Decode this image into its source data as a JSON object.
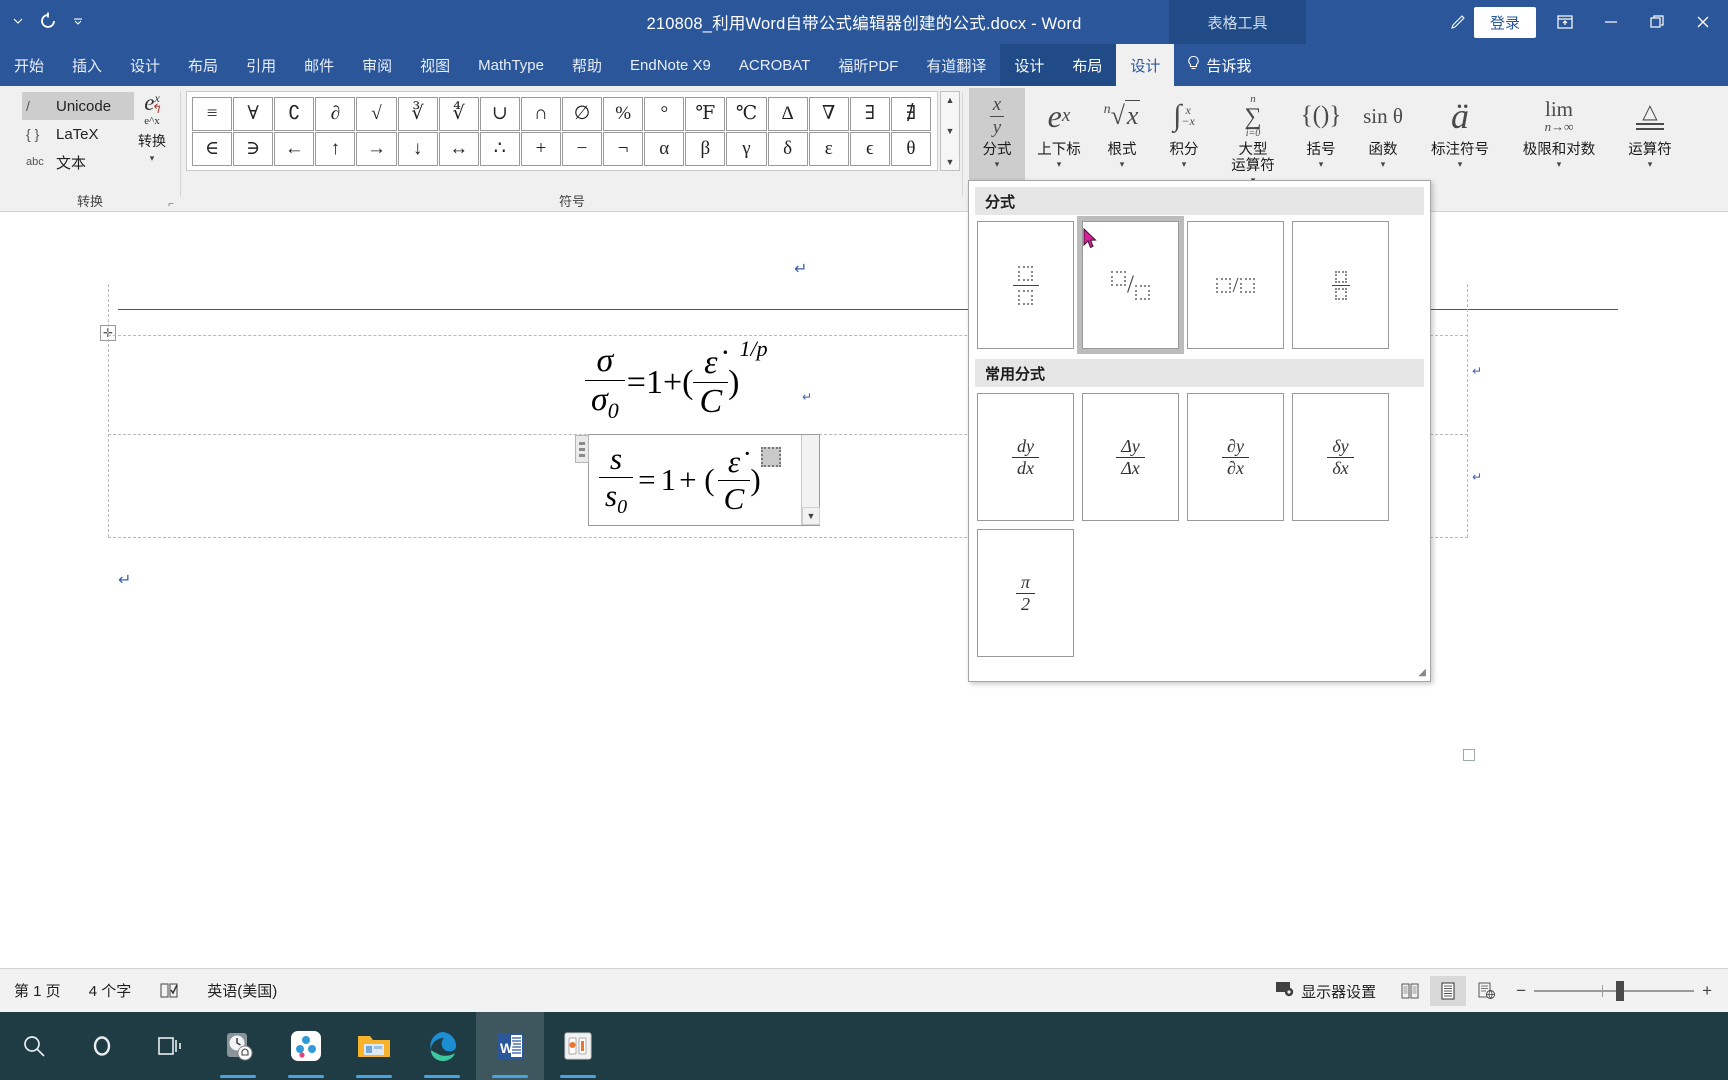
{
  "titlebar": {
    "document_title": "210808_利用Word自带公式编辑器创建的公式.docx  -  Word",
    "context_tool_label": "表格工具",
    "signin_label": "登录",
    "qat": [
      {
        "name": "autosave-caret",
        "label": "▾"
      },
      {
        "name": "undo-icon",
        "label": "↺"
      },
      {
        "name": "customize-qat-caret",
        "label": "⌄"
      }
    ],
    "window_controls": [
      {
        "name": "ribbon-display-options",
        "label": "⍐"
      },
      {
        "name": "minimize",
        "label": "—"
      },
      {
        "name": "restore",
        "label": "❐"
      },
      {
        "name": "close",
        "label": "✕"
      }
    ]
  },
  "ribbon_tabs": {
    "main": [
      "开始",
      "插入",
      "设计",
      "布局",
      "引用",
      "邮件",
      "审阅",
      "视图",
      "MathType",
      "帮助",
      "EndNote X9",
      "ACROBAT",
      "福昕PDF",
      "有道翻译"
    ],
    "contextual": [
      "设计",
      "布局"
    ],
    "active": "设计",
    "tellme_label": "告诉我"
  },
  "ribbon": {
    "groups": [
      {
        "name": "conversion",
        "label": "转换"
      },
      {
        "name": "symbols",
        "label": "符号"
      }
    ],
    "conversion": {
      "items": [
        {
          "mark": "/",
          "label": "Unicode",
          "selected": true
        },
        {
          "mark": "{ }",
          "label": "LaTeX",
          "selected": false
        },
        {
          "mark": "abc",
          "label": "文本",
          "selected": false
        }
      ],
      "convert_button": {
        "glyph": "e",
        "sup": "x",
        "sub": "e^x",
        "label": "转换",
        "caret": "▾"
      }
    },
    "symbols": {
      "row1": [
        "≡",
        "∀",
        "∁",
        "∂",
        "√",
        "∛",
        "∜",
        "∪",
        "∩",
        "∅",
        "%",
        "°",
        "℉",
        "℃",
        "Δ",
        "∇",
        "∃",
        "∄"
      ],
      "row2": [
        "∈",
        "∋",
        "←",
        "↑",
        "→",
        "↓",
        "↔",
        "∴",
        "+",
        "−",
        "¬",
        "α",
        "β",
        "γ",
        "δ",
        "ε",
        "ϵ",
        "θ"
      ],
      "scroll": [
        "▲",
        "▼",
        "▼"
      ]
    },
    "structures": [
      {
        "name": "fraction",
        "glyph_type": "frac",
        "num": "x",
        "den": "y",
        "label": "分式",
        "label2": "",
        "caret": "▾",
        "active": true
      },
      {
        "name": "script",
        "glyph_type": "text",
        "glyph": "e",
        "sup": "x",
        "label": "上下标",
        "label2": "",
        "caret": "▾",
        "active": false
      },
      {
        "name": "radical",
        "glyph_type": "radical",
        "glyph": "ⁿ√x",
        "label": "根式",
        "label2": "",
        "caret": "▾",
        "active": false
      },
      {
        "name": "integral",
        "glyph_type": "integral",
        "glyph": "∫",
        "sup": "x",
        "sub": "−x",
        "label": "积分",
        "label2": "",
        "caret": "▾",
        "active": false
      },
      {
        "name": "large-operator",
        "glyph_type": "sum",
        "glyph": "∑",
        "sup": "n",
        "sub": "i=0",
        "label": "大型",
        "label2": "运算符",
        "caret": "▾",
        "active": false
      },
      {
        "name": "bracket",
        "glyph_type": "text",
        "glyph": "{()}",
        "label": "括号",
        "label2": "",
        "caret": "▾",
        "active": false
      },
      {
        "name": "function",
        "glyph_type": "text",
        "glyph": "sin θ",
        "label": "函数",
        "label2": "",
        "caret": "▾",
        "active": false
      },
      {
        "name": "accent",
        "glyph_type": "accent",
        "glyph": "ä",
        "label": "标注符号",
        "label2": "",
        "caret": "▾",
        "active": false
      },
      {
        "name": "limit-log",
        "glyph_type": "limit",
        "glyph": "lim",
        "sub": "n→∞",
        "label": "极限和对数",
        "label2": "",
        "caret": "▾",
        "active": false
      },
      {
        "name": "operator",
        "glyph_type": "operator",
        "glyph": "≜",
        "label": "运算符",
        "label2": "",
        "caret": "▾",
        "active": false
      }
    ]
  },
  "gallery": {
    "sections": [
      {
        "name": "fraction-section",
        "header": "分式",
        "cells": [
          {
            "name": "stacked-fraction",
            "kind": "stacked-ph",
            "highlighted": false
          },
          {
            "name": "skewed-fraction",
            "kind": "skewed-ph",
            "highlighted": true
          },
          {
            "name": "linear-fraction",
            "kind": "linear-ph",
            "highlighted": false
          },
          {
            "name": "small-fraction",
            "kind": "small-ph",
            "highlighted": false
          }
        ]
      },
      {
        "name": "common-fraction-section",
        "header": "常用分式",
        "cells": [
          {
            "name": "dy-dx",
            "kind": "frac",
            "num": "dy",
            "den": "dx",
            "highlighted": false
          },
          {
            "name": "delta-y-delta-x",
            "kind": "frac",
            "num": "Δy",
            "den": "Δx",
            "highlighted": false
          },
          {
            "name": "partial-y-partial-x",
            "kind": "frac",
            "num": "∂y",
            "den": "∂x",
            "highlighted": false
          },
          {
            "name": "delta-small-y-x",
            "kind": "frac",
            "num": "δy",
            "den": "δx",
            "highlighted": false
          },
          {
            "name": "pi-over-2",
            "kind": "frac",
            "num": "π",
            "den": "2",
            "highlighted": false
          }
        ]
      }
    ]
  },
  "document": {
    "equation1": {
      "num": "σ",
      "den": "σ",
      "den_sub": "0",
      "equals": "=",
      "one_plus": "1+(",
      "inner_num": "ε̇",
      "inner_den": "C",
      "close_paren": ")",
      "exponent": "1/p"
    },
    "equation2": {
      "num": "s",
      "den": "s",
      "den_sub": "0",
      "equals": "=",
      "one": "1",
      "plus_paren": "+ (",
      "inner_num": "ε̇",
      "inner_den": "C",
      "close_paren": ")",
      "placeholder": "▨"
    }
  },
  "statusbar": {
    "page_info": "第 1 页",
    "word_count": "4 个字",
    "proofing_icon": "proofing-icon",
    "language": "英语(美国)",
    "display_settings": "显示器设置",
    "views": [
      {
        "name": "read-mode-view",
        "icon": "book-icon",
        "active": false
      },
      {
        "name": "print-layout-view",
        "icon": "page-icon",
        "active": true
      },
      {
        "name": "web-layout-view",
        "icon": "web-icon",
        "active": false
      }
    ],
    "zoom_out": "−",
    "zoom_in": "+"
  },
  "taskbar": {
    "items": [
      {
        "name": "search-icon",
        "label": "search",
        "active": false,
        "running": false
      },
      {
        "name": "cortana-icon",
        "label": "cortana",
        "active": false,
        "running": false
      },
      {
        "name": "task-view-icon",
        "label": "task-view",
        "active": false,
        "running": false
      },
      {
        "name": "clock-alarm-icon",
        "label": "alarms",
        "active": false,
        "running": true
      },
      {
        "name": "app-icon-blue",
        "label": "app",
        "active": false,
        "running": true
      },
      {
        "name": "file-explorer-icon",
        "label": "explorer",
        "active": false,
        "running": true
      },
      {
        "name": "edge-icon",
        "label": "edge",
        "active": false,
        "running": true
      },
      {
        "name": "word-icon",
        "label": "word",
        "active": true,
        "running": true
      },
      {
        "name": "snipping-tool-icon",
        "label": "snip",
        "active": false,
        "running": true
      }
    ]
  },
  "colors": {
    "word_blue": "#2b579a",
    "ctx_blue": "#204b87",
    "ribbon_bg": "#f0f0f0",
    "taskbar_bg": "#1f3b44",
    "highlight_gray": "#cdcdcd"
  }
}
